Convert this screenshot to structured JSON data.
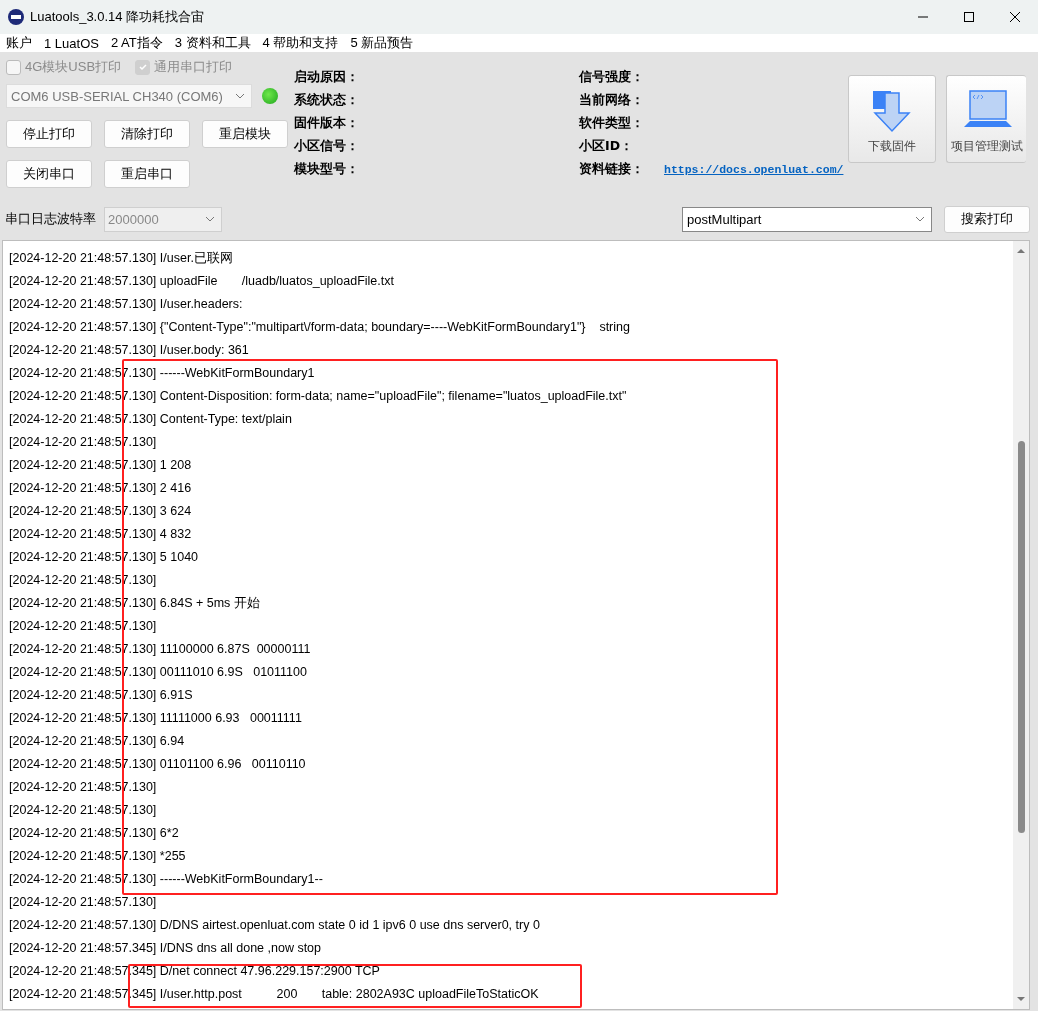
{
  "window": {
    "title": "Luatools_3.0.14 降功耗找合宙"
  },
  "menu": [
    "账户",
    "1 LuatOS",
    "2 AT指令",
    "3 资料和工具",
    "4 帮助和支持",
    "5 新品预告"
  ],
  "checkboxes": [
    {
      "label": "4G模块USB打印",
      "checked": false,
      "disabled": true
    },
    {
      "label": "通用串口打印",
      "checked": true,
      "disabled": true
    }
  ],
  "port_select": {
    "value": "COM6 USB-SERIAL CH340 (COM6)",
    "connected": true
  },
  "buttons": [
    [
      "停止打印",
      "清除打印",
      "重启模块"
    ],
    [
      "关闭串口",
      "重启串口"
    ]
  ],
  "info_left": [
    "启动原因：",
    "系统状态：",
    "固件版本：",
    "小区信号：",
    "模块型号："
  ],
  "info_right": [
    {
      "label": "信号强度："
    },
    {
      "label": "当前网络："
    },
    {
      "label": "软件类型："
    },
    {
      "label": "小区ID："
    },
    {
      "label": "资料链接：",
      "link": "https://docs.openluat.com/"
    }
  ],
  "big_buttons": [
    {
      "label": "下载固件",
      "kind": "download"
    },
    {
      "label": "项目管理测试",
      "kind": "project"
    }
  ],
  "baud": {
    "label": "串口日志波特率",
    "value": "2000000"
  },
  "filter": {
    "value": "postMultipart"
  },
  "search_button": "搜索打印",
  "log_lines": [
    "[2024-12-20 21:48:57.130] I/user.已联网",
    "[2024-12-20 21:48:57.130] uploadFile       /luadb/luatos_uploadFile.txt",
    "[2024-12-20 21:48:57.130] I/user.headers:",
    "[2024-12-20 21:48:57.130] {\"Content-Type\":\"multipart\\/form-data; boundary=----WebKitFormBoundary1\"}    string",
    "[2024-12-20 21:48:57.130] I/user.body: 361",
    "[2024-12-20 21:48:57.130] ------WebKitFormBoundary1",
    "[2024-12-20 21:48:57.130] Content-Disposition: form-data; name=\"uploadFile\"; filename=\"luatos_uploadFile.txt\"",
    "[2024-12-20 21:48:57.130] Content-Type: text/plain",
    "[2024-12-20 21:48:57.130]",
    "[2024-12-20 21:48:57.130] 1 208",
    "[2024-12-20 21:48:57.130] 2 416",
    "[2024-12-20 21:48:57.130] 3 624",
    "[2024-12-20 21:48:57.130] 4 832",
    "[2024-12-20 21:48:57.130] 5 1040",
    "[2024-12-20 21:48:57.130]",
    "[2024-12-20 21:48:57.130] 6.84S + 5ms 开始",
    "[2024-12-20 21:48:57.130]",
    "[2024-12-20 21:48:57.130] 11100000 6.87S  00000111",
    "[2024-12-20 21:48:57.130] 00111010 6.9S   01011100",
    "[2024-12-20 21:48:57.130] 6.91S",
    "[2024-12-20 21:48:57.130] 11111000 6.93   00011111",
    "[2024-12-20 21:48:57.130] 6.94",
    "[2024-12-20 21:48:57.130] 01101100 6.96   00110110",
    "[2024-12-20 21:48:57.130]",
    "[2024-12-20 21:48:57.130]",
    "[2024-12-20 21:48:57.130] 6*2",
    "[2024-12-20 21:48:57.130] *255",
    "[2024-12-20 21:48:57.130] ------WebKitFormBoundary1--",
    "[2024-12-20 21:48:57.130]",
    "[2024-12-20 21:48:57.130] D/DNS airtest.openluat.com state 0 id 1 ipv6 0 use dns server0, try 0",
    "[2024-12-20 21:48:57.345] I/DNS dns all done ,now stop",
    "[2024-12-20 21:48:57.345] D/net connect 47.96.229.157:2900 TCP",
    "[2024-12-20 21:48:57.345] I/user.http.post          200       table: 2802A93C uploadFileToStaticOK"
  ]
}
